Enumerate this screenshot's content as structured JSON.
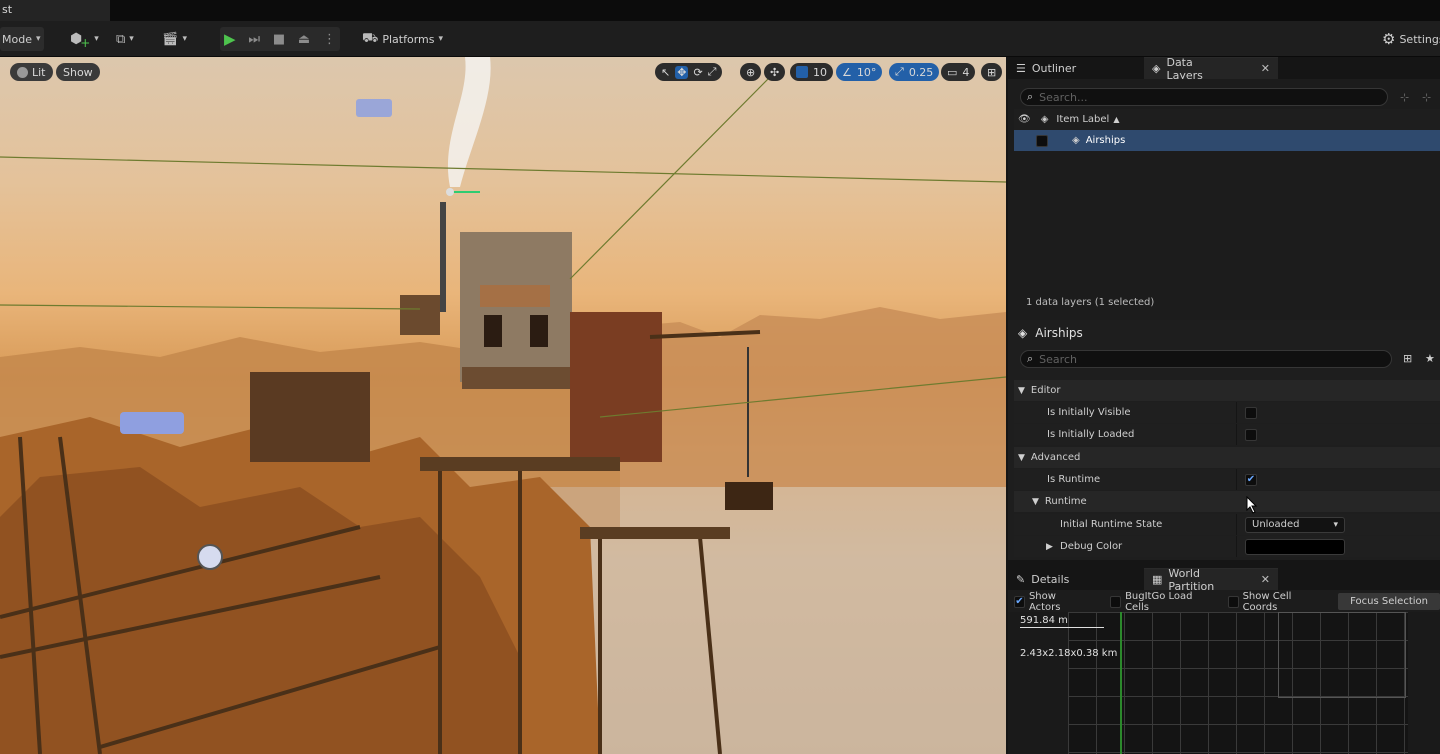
{
  "title": {
    "tab_label": "st"
  },
  "toolbar": {
    "mode_label": "Mode",
    "platforms_label": "Platforms",
    "settings_label": "Settings"
  },
  "viewport": {
    "lit_label": "Lit",
    "show_label": "Show",
    "grid_snap": "10",
    "rotate_snap": "10°",
    "scale_snap": "0.25",
    "camera_speed": "4"
  },
  "outliner_tabs": {
    "outliner": "Outliner",
    "data_layers": "Data Layers"
  },
  "data_layers": {
    "search_placeholder": "Search...",
    "column_header": "Item Label",
    "sort_indicator": "▲",
    "items": [
      {
        "label": "Airships"
      }
    ],
    "status": "1 data layers (1 selected)"
  },
  "details_layer": {
    "title": "Airships",
    "search_placeholder": "Search",
    "categories": {
      "editor": "Editor",
      "advanced": "Advanced",
      "runtime": "Runtime"
    },
    "props": {
      "is_initially_visible": "Is Initially Visible",
      "is_initially_loaded": "Is Initially Loaded",
      "is_runtime": "Is Runtime",
      "initial_runtime_state": "Initial Runtime State",
      "initial_runtime_state_value": "Unloaded",
      "debug_color": "Debug Color"
    }
  },
  "bottom_tabs": {
    "details": "Details",
    "world_partition": "World Partition"
  },
  "world_partition": {
    "show_actors": "Show Actors",
    "bugitgo": "BugItGo Load Cells",
    "show_cell_coords": "Show Cell Coords",
    "focus_selection": "Focus Selection",
    "scale_label": "591.84 m",
    "size_label": "2.43x2.18x0.38 km"
  },
  "colors": {
    "accent_blue": "#2360a8",
    "play_green": "#4ec44e",
    "selected_row": "#2f4a6e"
  }
}
